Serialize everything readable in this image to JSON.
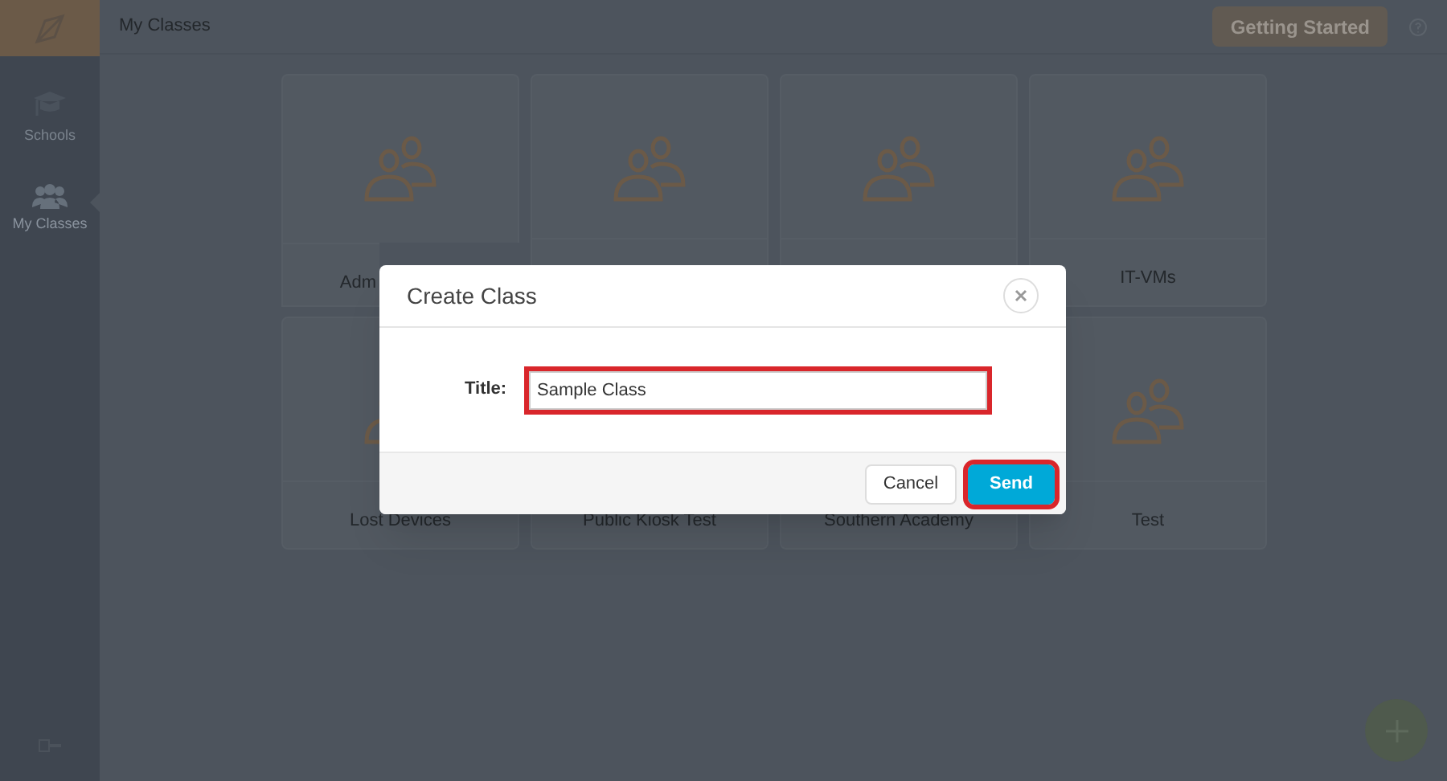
{
  "header": {
    "title": "My Classes",
    "button": "Getting Started"
  },
  "sidebar": {
    "items": [
      {
        "label": "Schools",
        "selected": false
      },
      {
        "label": "My Classes",
        "selected": true
      }
    ]
  },
  "classes": [
    {
      "kind": "class",
      "label": "Adm",
      "cut_by_dialog": true
    },
    {
      "kind": "class"
    },
    {
      "kind": "class"
    },
    {
      "kind": "class",
      "label": "IT-VMs"
    },
    {
      "kind": "class",
      "label": "Lost Devices"
    },
    {
      "kind": "class",
      "label": "Public Kiosk Test"
    },
    {
      "kind": "class",
      "label": "Southern Academy"
    },
    {
      "kind": "class",
      "label": "Test"
    }
  ],
  "dialog": {
    "title": "Create Class",
    "field": {
      "label": "Title:",
      "value": "Sample Class",
      "highlighted": true
    },
    "buttons": [
      {
        "label": "Cancel",
        "kind": "secondary",
        "highlighted": false
      },
      {
        "label": "Send",
        "kind": "primary",
        "highlighted": true
      }
    ]
  }
}
